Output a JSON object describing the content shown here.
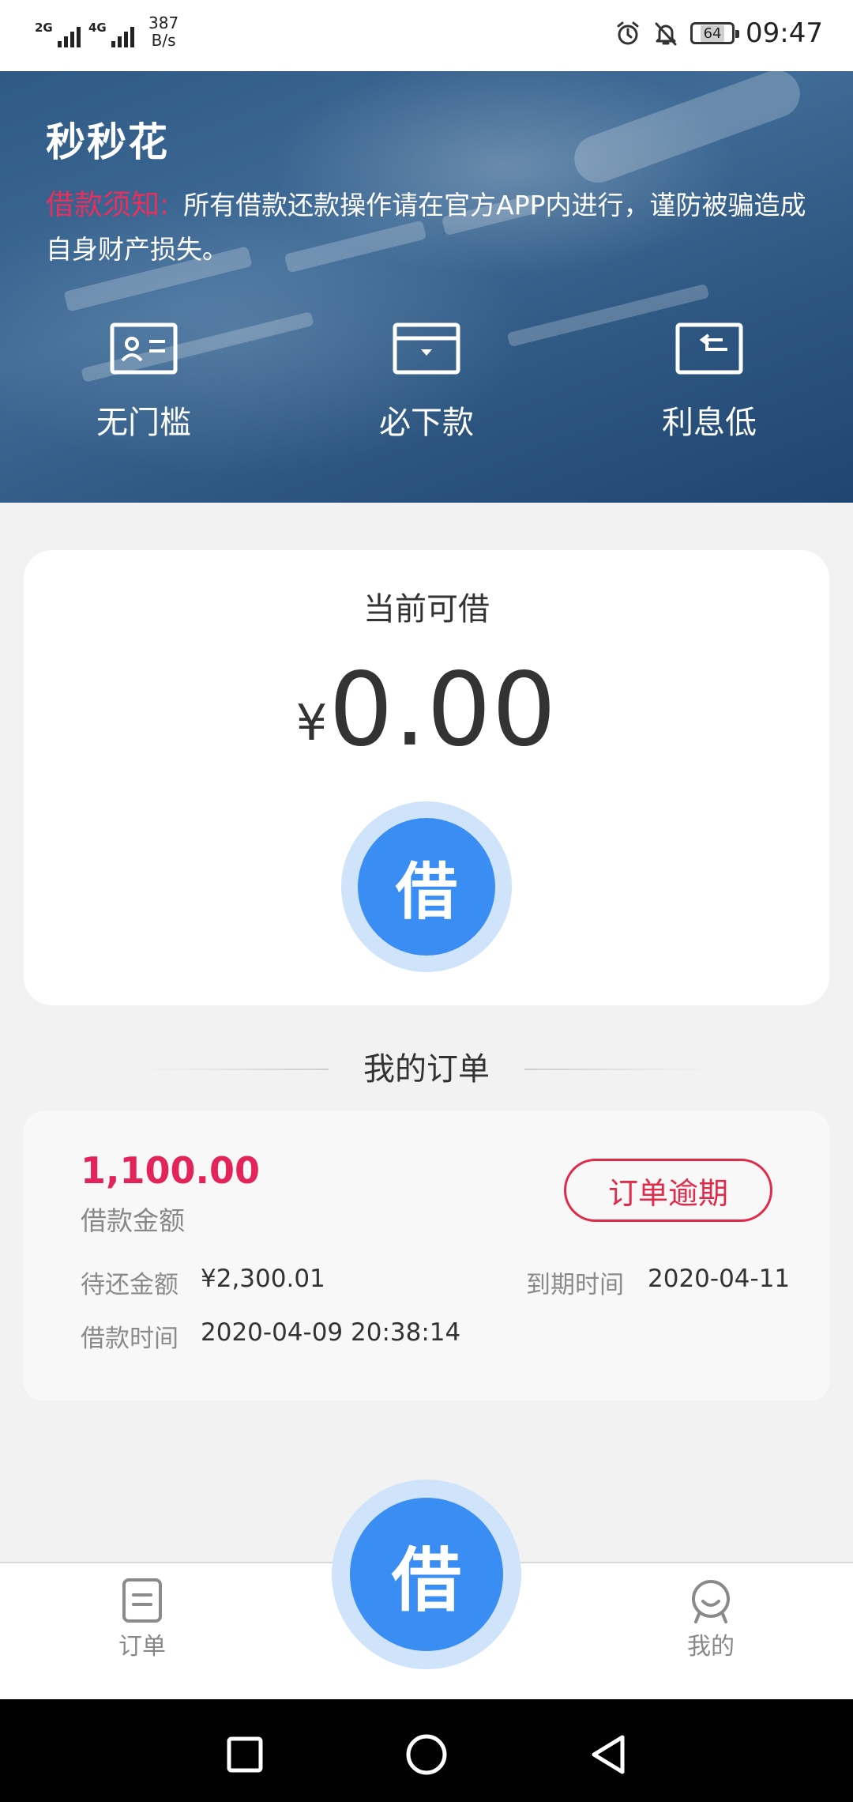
{
  "status_bar": {
    "signal1": "2G",
    "signal2": "4G",
    "net_speed_value": "387",
    "net_speed_unit": "B/s",
    "battery": "64",
    "time": "09:47"
  },
  "banner": {
    "app_title": "秒秒花",
    "notice_label": "借款须知:",
    "notice_text": "所有借款还款操作请在官方APP内进行，谨防被骗造成自身财产损失。",
    "features": [
      {
        "label": "无门槛",
        "icon": "id-card-icon"
      },
      {
        "label": "必下款",
        "icon": "wallet-icon"
      },
      {
        "label": "利息低",
        "icon": "return-card-icon"
      }
    ]
  },
  "loan_card": {
    "label": "当前可借",
    "currency": "¥",
    "amount": "0.00",
    "button_label": "借"
  },
  "orders": {
    "section_title": "我的订单",
    "items": [
      {
        "amount": "1,100.00",
        "amount_label": "借款金额",
        "status": "订单逾期",
        "repay_label": "待还金额",
        "repay_value": "¥2,300.01",
        "due_label": "到期时间",
        "due_value": "2020-04-11",
        "borrow_time_label": "借款时间",
        "borrow_time_value": "2020-04-09 20:38:14"
      }
    ]
  },
  "fab": {
    "label": "借"
  },
  "tab_bar": {
    "tabs": [
      {
        "label": "订单",
        "icon": "document-icon"
      },
      {
        "label": "我的",
        "icon": "user-icon"
      }
    ]
  },
  "colors": {
    "accent": "#3a8ef3",
    "accent_ring": "#cfe4fb",
    "alert_red": "#e02a4a",
    "amount_red": "#e2245a",
    "banner_blue": "#2f5a86"
  }
}
